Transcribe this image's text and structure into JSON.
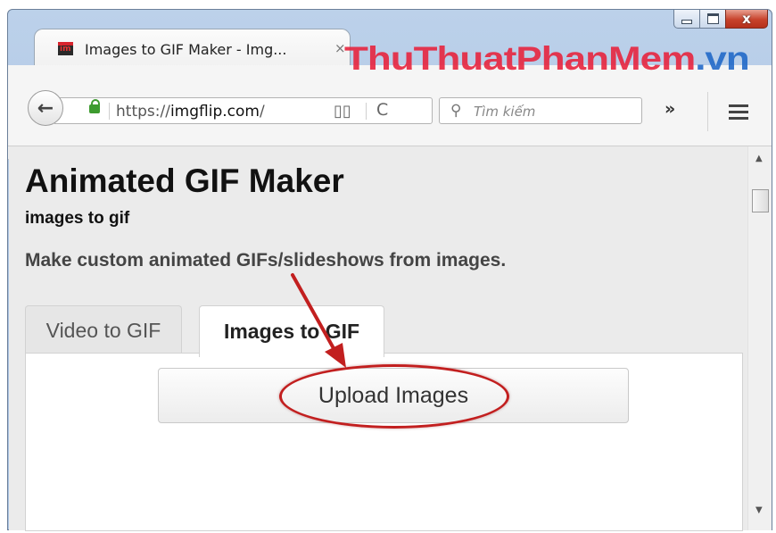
{
  "browser": {
    "tab_title": "Images to GIF Maker - Img...",
    "tab_close_glyph": "×",
    "watermark_main": "ThuThuatPhanMem",
    "watermark_tld": ".vn",
    "url_prefix": "https://",
    "url_domain": "imgflip.com",
    "url_suffix": "/",
    "search_placeholder": "Tìm kiếm",
    "overflow_glyph": "»",
    "back_glyph": "←",
    "reload_glyph": "C",
    "reader_glyph": "▯▯",
    "window_close_glyph": "x"
  },
  "page": {
    "title": "Animated GIF Maker",
    "subtitle": "images to gif",
    "description": "Make custom animated GIFs/slideshows from images.",
    "tabs": [
      {
        "label": "Video to GIF",
        "active": false
      },
      {
        "label": "Images to GIF",
        "active": true
      }
    ],
    "upload_button": "Upload Images"
  },
  "icons": {
    "favicon": "imgflip-favicon",
    "lock": "lock-icon",
    "search": "search-icon",
    "menu": "hamburger-menu-icon"
  },
  "colors": {
    "annotation": "#c21f1f",
    "watermark_red": "#e8203a",
    "watermark_blue": "#1e67c8",
    "secure_lock": "#3d9b2f"
  }
}
